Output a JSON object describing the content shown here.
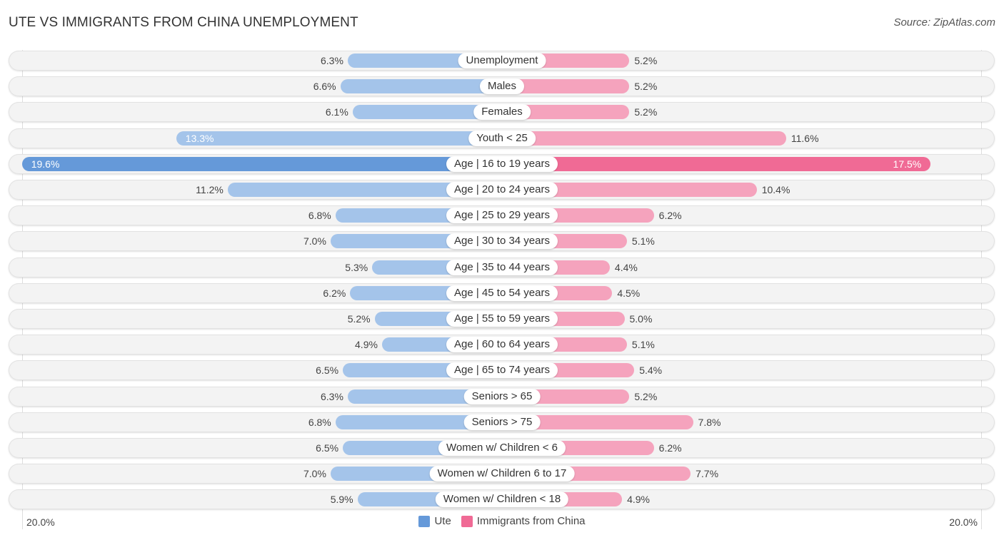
{
  "title": "UTE VS IMMIGRANTS FROM CHINA UNEMPLOYMENT",
  "source": "Source: ZipAtlas.com",
  "colors": {
    "ute": "#a4c4ea",
    "ute_highlight": "#6599d9",
    "china": "#f5a3bd",
    "china_highlight": "#f06a95",
    "legend_ute": "#6599d9",
    "legend_china": "#f06a95"
  },
  "chart_data": {
    "type": "bar",
    "orientation": "horizontal-diverging",
    "title": "UTE VS IMMIGRANTS FROM CHINA UNEMPLOYMENT",
    "axis_max_label_left": "20.0%",
    "axis_max_label_right": "20.0%",
    "xlim": [
      0,
      20
    ],
    "unit": "%",
    "legend_position": "bottom-center",
    "categories": [
      "Unemployment",
      "Males",
      "Females",
      "Youth < 25",
      "Age | 16 to 19 years",
      "Age | 20 to 24 years",
      "Age | 25 to 29 years",
      "Age | 30 to 34 years",
      "Age | 35 to 44 years",
      "Age | 45 to 54 years",
      "Age | 55 to 59 years",
      "Age | 60 to 64 years",
      "Age | 65 to 74 years",
      "Seniors > 65",
      "Seniors > 75",
      "Women w/ Children < 6",
      "Women w/ Children 6 to 17",
      "Women w/ Children < 18"
    ],
    "series": [
      {
        "name": "Ute",
        "side": "left",
        "values": [
          6.3,
          6.6,
          6.1,
          13.3,
          19.6,
          11.2,
          6.8,
          7.0,
          5.3,
          6.2,
          5.2,
          4.9,
          6.5,
          6.3,
          6.8,
          6.5,
          7.0,
          5.9
        ],
        "labels": [
          "6.3%",
          "6.6%",
          "6.1%",
          "13.3%",
          "19.6%",
          "11.2%",
          "6.8%",
          "7.0%",
          "5.3%",
          "6.2%",
          "5.2%",
          "4.9%",
          "6.5%",
          "6.3%",
          "6.8%",
          "6.5%",
          "7.0%",
          "5.9%"
        ]
      },
      {
        "name": "Immigrants from China",
        "side": "right",
        "values": [
          5.2,
          5.2,
          5.2,
          11.6,
          17.5,
          10.4,
          6.2,
          5.1,
          4.4,
          4.5,
          5.0,
          5.1,
          5.4,
          5.2,
          7.8,
          6.2,
          7.7,
          4.9
        ],
        "labels": [
          "5.2%",
          "5.2%",
          "5.2%",
          "11.6%",
          "17.5%",
          "10.4%",
          "6.2%",
          "5.1%",
          "4.4%",
          "4.5%",
          "5.0%",
          "5.1%",
          "5.4%",
          "5.2%",
          "7.8%",
          "6.2%",
          "7.7%",
          "4.9%"
        ]
      }
    ],
    "highlight_index": 4,
    "inside_label_indices_left": [
      3,
      4
    ],
    "inside_label_indices_right": [
      4
    ]
  },
  "legend": [
    {
      "label": "Ute",
      "color": "#6599d9"
    },
    {
      "label": "Immigrants from China",
      "color": "#f06a95"
    }
  ]
}
